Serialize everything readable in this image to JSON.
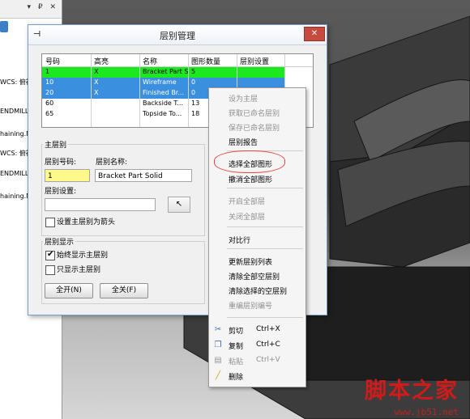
{
  "background_panel": {
    "lines": [
      "WCS: 俯视",
      "ENDMILL",
      "haining.N",
      "WCS: 俯视",
      "ENDMILL",
      "haining.N"
    ],
    "buttons": "▾ ₽ ✕"
  },
  "dialog": {
    "title": "层别管理",
    "close": "✕",
    "pin": "⊣"
  },
  "table": {
    "headers": [
      "号码",
      "高亮",
      "名称",
      "图形数量",
      "层别设置"
    ],
    "rows": [
      {
        "num": "1",
        "highlight": "X",
        "name": "Bracket Part S",
        "count": "5",
        "setting": "",
        "state": "green"
      },
      {
        "num": "10",
        "highlight": "X",
        "name": "Wireframe",
        "count": "0",
        "setting": "",
        "state": "blue"
      },
      {
        "num": "20",
        "highlight": "X",
        "name": "Finished Br...",
        "count": "0",
        "setting": "",
        "state": "blue"
      },
      {
        "num": "60",
        "highlight": "",
        "name": "Backside T...",
        "count": "13",
        "setting": "",
        "state": "white"
      },
      {
        "num": "65",
        "highlight": "",
        "name": "Topside To...",
        "count": "18",
        "setting": "",
        "state": "white"
      }
    ]
  },
  "main_layer": {
    "title": "主层别",
    "number_label": "层别号码:",
    "number_value": "1",
    "name_label": "层别名称:",
    "name_value": "Bracket Part Solid",
    "setting_label": "层别设置:",
    "setting_value": "",
    "cursor_btn": "↖",
    "arrow_checkbox_label": "设置主层别为箭头",
    "arrow_checked": false
  },
  "display": {
    "title": "层别显示",
    "always_show_label": "始终显示主层别",
    "always_show_checked": true,
    "only_show_label": "只显示主层别",
    "only_show_checked": false,
    "all_on": "全开(N)",
    "all_off": "全关(F)"
  },
  "context_menu": {
    "items": [
      {
        "label": "设为主层",
        "shortcut": "",
        "disabled": true,
        "icon": ""
      },
      {
        "label": "获取已命名层别",
        "shortcut": "",
        "disabled": true,
        "icon": ""
      },
      {
        "label": "保存已命名层别",
        "shortcut": "",
        "disabled": true,
        "icon": ""
      },
      {
        "label": "层别报告",
        "shortcut": "",
        "disabled": false,
        "icon": ""
      },
      {
        "label": "选择全部图形",
        "shortcut": "",
        "disabled": false,
        "icon": ""
      },
      {
        "label": "撤消全部图形",
        "shortcut": "",
        "disabled": false,
        "icon": ""
      },
      {
        "label": "开启全部层",
        "shortcut": "",
        "disabled": true,
        "icon": ""
      },
      {
        "label": "关闭全部层",
        "shortcut": "",
        "disabled": true,
        "icon": ""
      },
      {
        "label": "对比行",
        "shortcut": "",
        "disabled": false,
        "icon": ""
      },
      {
        "label": "更新层别列表",
        "shortcut": "",
        "disabled": false,
        "icon": ""
      },
      {
        "label": "清除全部空层别",
        "shortcut": "",
        "disabled": false,
        "icon": ""
      },
      {
        "label": "清除选择的空层别",
        "shortcut": "",
        "disabled": false,
        "icon": ""
      },
      {
        "label": "重编层别编号",
        "shortcut": "",
        "disabled": true,
        "icon": ""
      },
      {
        "label": "剪切",
        "shortcut": "Ctrl+X",
        "disabled": false,
        "icon": "scissors-icon"
      },
      {
        "label": "复制",
        "shortcut": "Ctrl+C",
        "disabled": false,
        "icon": "copy-icon"
      },
      {
        "label": "粘贴",
        "shortcut": "Ctrl+V",
        "disabled": true,
        "icon": "paste-icon"
      },
      {
        "label": "删除",
        "shortcut": "",
        "disabled": false,
        "icon": "delete-icon"
      }
    ]
  },
  "watermark": {
    "logo": "脚本之家",
    "url": "www.jb51.net"
  },
  "colors": {
    "green_row": "#1be81f",
    "blue_row": "#3a8fde",
    "number_field": "#fff98c",
    "highlight_ring": "#e0443c",
    "watermark": "#d11a1a"
  }
}
